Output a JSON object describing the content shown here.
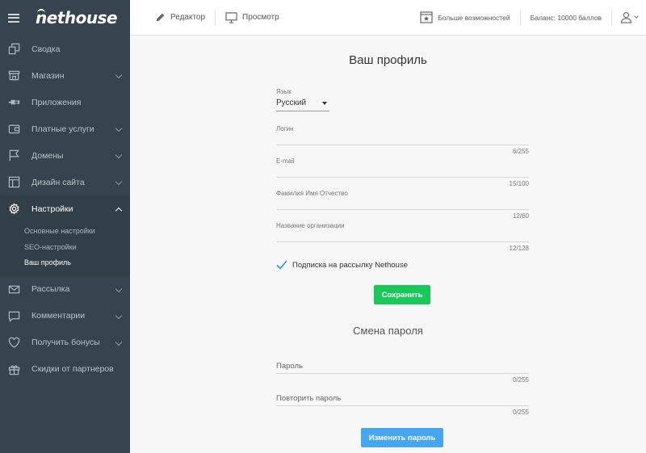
{
  "brand": {
    "logo": "nethouse"
  },
  "sidebar": {
    "items": [
      {
        "label": "Сводка",
        "icon": "dashboard-icon",
        "chevron": false
      },
      {
        "label": "Магазин",
        "icon": "store-icon",
        "chevron": true
      },
      {
        "label": "Приложения",
        "icon": "plug-icon",
        "chevron": false
      },
      {
        "label": "Платные услуги",
        "icon": "wallet-icon",
        "chevron": true
      },
      {
        "label": "Домены",
        "icon": "flag-icon",
        "chevron": true
      },
      {
        "label": "Дизайн сайта",
        "icon": "layout-icon",
        "chevron": true
      },
      {
        "label": "Настройки",
        "icon": "gear-icon",
        "chevron": true,
        "active": true
      },
      {
        "label": "Рассылка",
        "icon": "mail-icon",
        "chevron": true
      },
      {
        "label": "Комментарии",
        "icon": "comment-icon",
        "chevron": true
      },
      {
        "label": "Получить бонусы",
        "icon": "heart-icon",
        "chevron": true
      },
      {
        "label": "Скидки от партнеров",
        "icon": "gift-icon",
        "chevron": false
      }
    ],
    "settings_sub": [
      {
        "label": "Основные настройки"
      },
      {
        "label": "SEO-настройки"
      },
      {
        "label": "Ваш профиль",
        "current": true
      }
    ]
  },
  "topbar": {
    "editor_label": "Редактор",
    "preview_label": "Просмотр",
    "more_label": "Больше возможностей",
    "balance_label": "Баланс: 10000 баллов"
  },
  "profile": {
    "title": "Ваш профиль",
    "language_label": "Язык",
    "language_value": "Русский",
    "login_label": "Логин",
    "login_count": "6/255",
    "email_label": "E-mail",
    "email_count": "15/100",
    "fio_label": "Фамилия Имя Отчество",
    "fio_count": "12/60",
    "org_label": "Название организации",
    "org_count": "12/128",
    "subscribe_label": "Подписка на рассылку Nethouse",
    "subscribe_checked": true,
    "save_label": "Сохранить"
  },
  "password": {
    "title": "Смена пароля",
    "password_label": "Пароль",
    "password_count": "0/255",
    "repeat_label": "Повторить пароль",
    "repeat_count": "0/255",
    "change_label": "Изменить пароль"
  },
  "colors": {
    "sidebar_bg": "#37444f",
    "save_button": "#18c95a",
    "change_button": "#46a6f0",
    "check": "#2f8fd8"
  }
}
